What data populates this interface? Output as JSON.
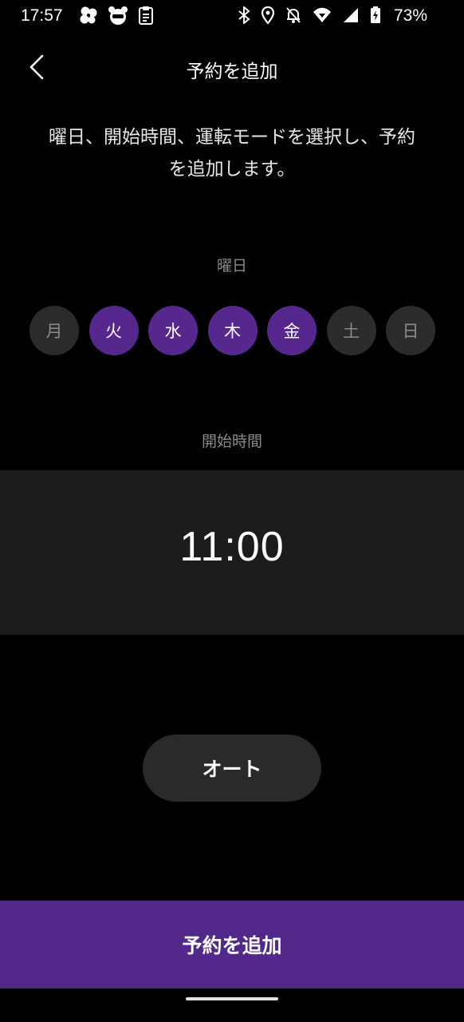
{
  "status_bar": {
    "time": "17:57",
    "battery": "73%",
    "left_icons": [
      "fan-app-icon",
      "bear-app-icon",
      "clipboard-icon"
    ],
    "right_icons": [
      "bluetooth-icon",
      "location-icon",
      "bell-off-icon",
      "wifi-icon",
      "signal-icon",
      "battery-charging-icon"
    ]
  },
  "header": {
    "title": "予約を追加",
    "back_icon": "chevron-left-icon"
  },
  "description": "曜日、開始時間、運転モードを選択し、予約を追加します。",
  "weekday": {
    "label": "曜日",
    "days": [
      {
        "label": "月",
        "selected": false
      },
      {
        "label": "火",
        "selected": true
      },
      {
        "label": "水",
        "selected": true
      },
      {
        "label": "木",
        "selected": true
      },
      {
        "label": "金",
        "selected": true
      },
      {
        "label": "土",
        "selected": false
      },
      {
        "label": "日",
        "selected": false
      }
    ]
  },
  "start_time": {
    "label": "開始時間",
    "value": "11:00"
  },
  "mode": {
    "label": "オート"
  },
  "add_button": {
    "label": "予約を追加"
  },
  "colors": {
    "background": "#000000",
    "accent": "#52288b",
    "day_selected": "#56288e",
    "day_unselected": "#2c2c2c",
    "time_panel": "#1c1c1c"
  }
}
